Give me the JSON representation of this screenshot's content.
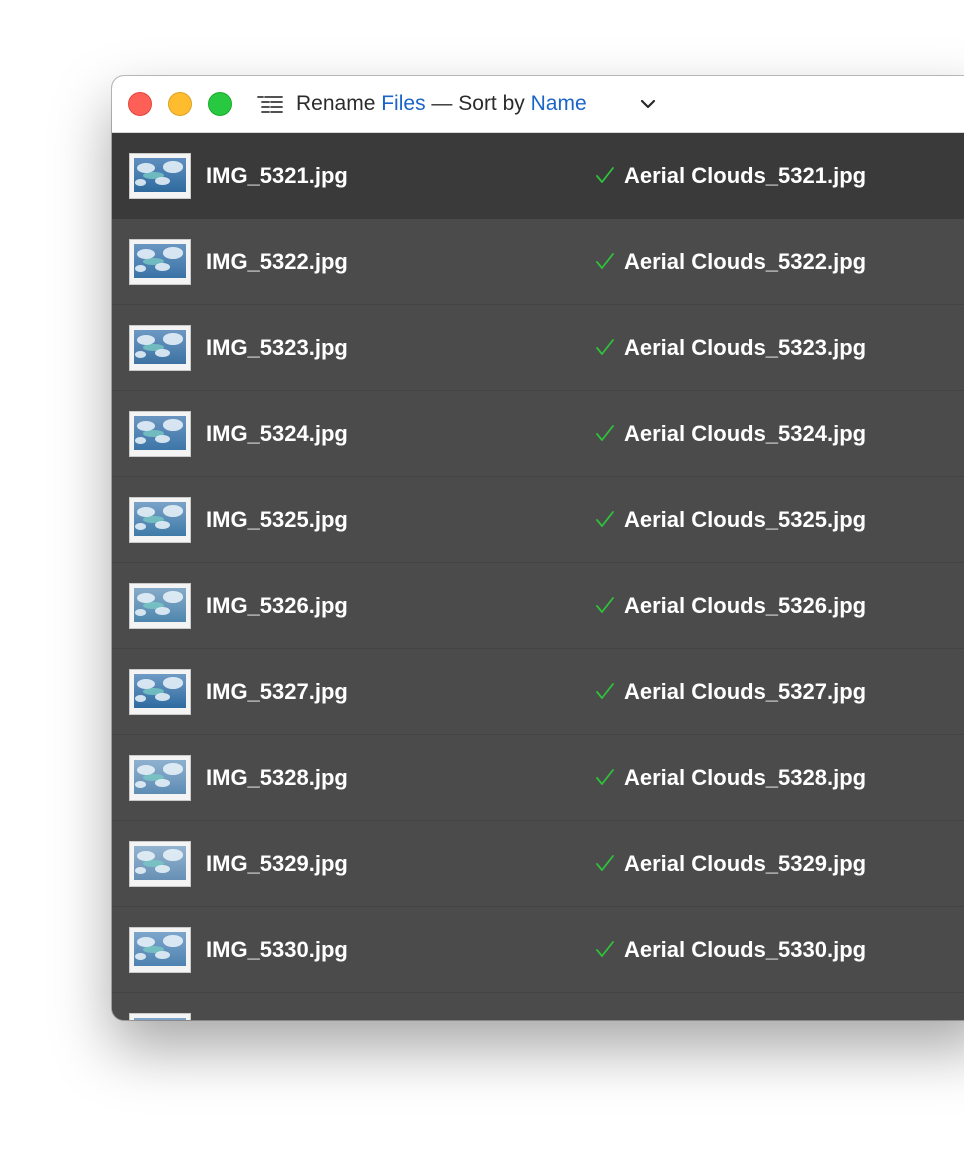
{
  "window": {
    "title_prefix": "Rename",
    "title_files": "Files",
    "title_separator": "— Sort by",
    "title_sort": "Name",
    "accent_color": "#1b64c8",
    "check_color": "#2ec23a"
  },
  "icons": {
    "title_icon": "list-icon",
    "menu_icon": "chevron-down-icon",
    "status_icon": "checkmark-icon",
    "thumbnail_icon": "image-thumbnail"
  },
  "files": [
    {
      "original": "IMG_5321.jpg",
      "renamed": "Aerial Clouds_5321.jpg",
      "selected": true,
      "sky": [
        "#5f8fbf",
        "#2f6a9e"
      ]
    },
    {
      "original": "IMG_5322.jpg",
      "renamed": "Aerial Clouds_5322.jpg",
      "selected": false,
      "sky": [
        "#6a96c2",
        "#3a73a6"
      ]
    },
    {
      "original": "IMG_5323.jpg",
      "renamed": "Aerial Clouds_5323.jpg",
      "selected": false,
      "sky": [
        "#6d98c3",
        "#3c72a2"
      ]
    },
    {
      "original": "IMG_5324.jpg",
      "renamed": "Aerial Clouds_5324.jpg",
      "selected": false,
      "sky": [
        "#6b95c0",
        "#3d76a8"
      ]
    },
    {
      "original": "IMG_5325.jpg",
      "renamed": "Aerial Clouds_5325.jpg",
      "selected": false,
      "sky": [
        "#7aa3c8",
        "#3f7aa8"
      ]
    },
    {
      "original": "IMG_5326.jpg",
      "renamed": "Aerial Clouds_5326.jpg",
      "selected": false,
      "sky": [
        "#86abc9",
        "#4f86ad"
      ]
    },
    {
      "original": "IMG_5327.jpg",
      "renamed": "Aerial Clouds_5327.jpg",
      "selected": false,
      "sky": [
        "#6f9bc4",
        "#2e6aa0"
      ]
    },
    {
      "original": "IMG_5328.jpg",
      "renamed": "Aerial Clouds_5328.jpg",
      "selected": false,
      "sky": [
        "#8fb1cf",
        "#5e8cb3"
      ]
    },
    {
      "original": "IMG_5329.jpg",
      "renamed": "Aerial Clouds_5329.jpg",
      "selected": false,
      "sky": [
        "#93b3cf",
        "#6790b5"
      ]
    },
    {
      "original": "IMG_5330.jpg",
      "renamed": "Aerial Clouds_5330.jpg",
      "selected": false,
      "sky": [
        "#7ea6cb",
        "#4e82b0"
      ]
    },
    {
      "original": "",
      "renamed": "",
      "selected": false,
      "sky": [
        "#7ea6cb",
        "#4e82b0"
      ]
    }
  ]
}
